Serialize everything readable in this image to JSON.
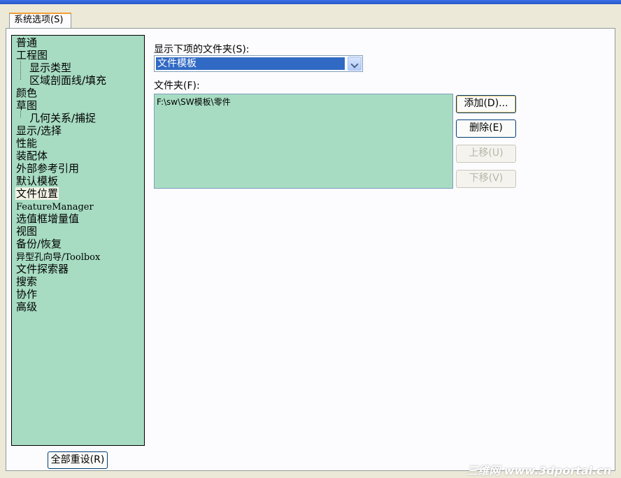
{
  "tabs": [
    {
      "label": "系统选项(S)"
    }
  ],
  "tree": {
    "items": [
      {
        "label": "普通"
      },
      {
        "label": "工程图"
      },
      {
        "label": "显示类型"
      },
      {
        "label": "区域剖面线/填充"
      },
      {
        "label": "颜色"
      },
      {
        "label": "草图"
      },
      {
        "label": "几何关系/捕捉"
      },
      {
        "label": "显示/选择"
      },
      {
        "label": "性能"
      },
      {
        "label": "装配体"
      },
      {
        "label": "外部参考引用"
      },
      {
        "label": "默认模板"
      },
      {
        "label": "文件位置"
      },
      {
        "label": "FeatureManager"
      },
      {
        "label": "选值框增量值"
      },
      {
        "label": "视图"
      },
      {
        "label": "备份/恢复"
      },
      {
        "label": "异型孔向导/Toolbox"
      },
      {
        "label": "文件探索器"
      },
      {
        "label": "搜索"
      },
      {
        "label": "协作"
      },
      {
        "label": "高级"
      }
    ],
    "selected": "文件位置"
  },
  "reset_button": {
    "label": "全部重设(R)"
  },
  "show_folders": {
    "label": "显示下项的文件夹(S):",
    "value": "文件模板"
  },
  "folders": {
    "label": "文件夹(F):",
    "rows": [
      "F:\\sw\\SW模板\\零件"
    ]
  },
  "buttons": {
    "add": "添加(D)...",
    "delete": "删除(E)",
    "move_up": "上移(U)",
    "move_down": "下移(V)"
  },
  "watermark": "三维网 www.3dportal.cn",
  "colors": {
    "panel_bg": "#a7dcc2",
    "selection": "#316ac5",
    "tab_accent": "#f0a030"
  }
}
